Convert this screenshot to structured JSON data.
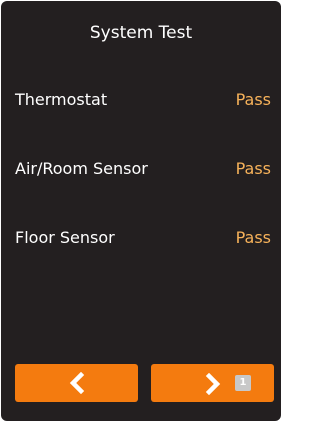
{
  "screen": {
    "title": "System Test"
  },
  "tests": [
    {
      "label": "Thermostat",
      "status": "Pass"
    },
    {
      "label": "Air/Room Sensor",
      "status": "Pass"
    },
    {
      "label": "Floor Sensor",
      "status": "Pass"
    }
  ],
  "navigation": {
    "back_icon": "chevron-left-icon",
    "next_icon": "chevron-right-icon",
    "page_badge": "1"
  },
  "colors": {
    "background": "#231f20",
    "accent": "#f47b0f",
    "status_pass": "#f7b25a",
    "badge": "#c8c8c8"
  }
}
